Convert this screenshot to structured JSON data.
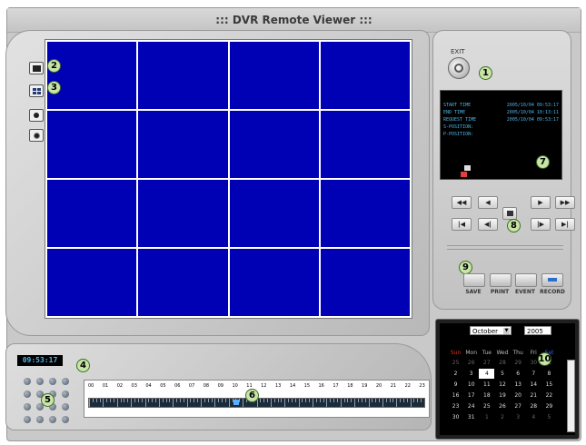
{
  "window": {
    "title": "::: DVR Remote Viewer :::"
  },
  "exit": {
    "label": "EXIT"
  },
  "callouts": {
    "c1": "1",
    "c2": "2",
    "c3": "3",
    "c4": "4",
    "c5": "5",
    "c6": "6",
    "c7": "7",
    "c8": "8",
    "c9": "9",
    "c10": "10"
  },
  "info": {
    "start_label": "START TIME",
    "start_value": "2005/10/04 09:53:17",
    "end_label": "END TIME",
    "end_value": "2005/10/04 10:13:11",
    "request_label": "REQUEST TIME",
    "request_value": "2005/10/04 09:53:17",
    "s_position": "S-POSITION:",
    "p_position": "P-POSITION:"
  },
  "playback": {
    "rewind_fast": "◀◀",
    "rewind": "◀",
    "play": "▶",
    "forward_fast": "▶▶",
    "skip_start": "|◀",
    "step_back": "◀|",
    "step_forward": "|▶",
    "skip_end": "▶|"
  },
  "actions": {
    "save": "SAVE",
    "print": "PRINT",
    "event": "EVENT",
    "record": "RECORD"
  },
  "time_display": "09:53:17",
  "timeline": {
    "hours": [
      "00",
      "01",
      "02",
      "03",
      "04",
      "05",
      "06",
      "07",
      "08",
      "09",
      "10",
      "11",
      "12",
      "13",
      "14",
      "15",
      "16",
      "17",
      "18",
      "19",
      "20",
      "21",
      "22",
      "23"
    ],
    "position_fraction": 0.43
  },
  "calendar": {
    "month": "October",
    "year": "2005",
    "weekdays": [
      "Sun",
      "Mon",
      "Tue",
      "Wed",
      "Thu",
      "Fri",
      "Sat"
    ],
    "weeks": [
      [
        "25",
        "26",
        "27",
        "28",
        "29",
        "30",
        "1"
      ],
      [
        "2",
        "3",
        "4",
        "5",
        "6",
        "7",
        "8"
      ],
      [
        "9",
        "10",
        "11",
        "12",
        "13",
        "14",
        "15"
      ],
      [
        "16",
        "17",
        "18",
        "19",
        "20",
        "21",
        "22"
      ],
      [
        "23",
        "24",
        "25",
        "26",
        "27",
        "28",
        "29"
      ],
      [
        "30",
        "31",
        "1",
        "2",
        "3",
        "4",
        "5"
      ]
    ],
    "selected_day": "4",
    "colors": {
      "sunday": "#e03020",
      "saturday": "#3060ff"
    }
  },
  "icons": {
    "exit": "power-icon",
    "layout_single": "single-view-icon",
    "layout_quad": "quad-view-icon",
    "snapshot": "camera-icon",
    "zoom": "zoom-icon"
  },
  "colors": {
    "video_cell": "#0000b4",
    "info_text": "#4fb3e6",
    "panel": "#c9c9c9"
  }
}
